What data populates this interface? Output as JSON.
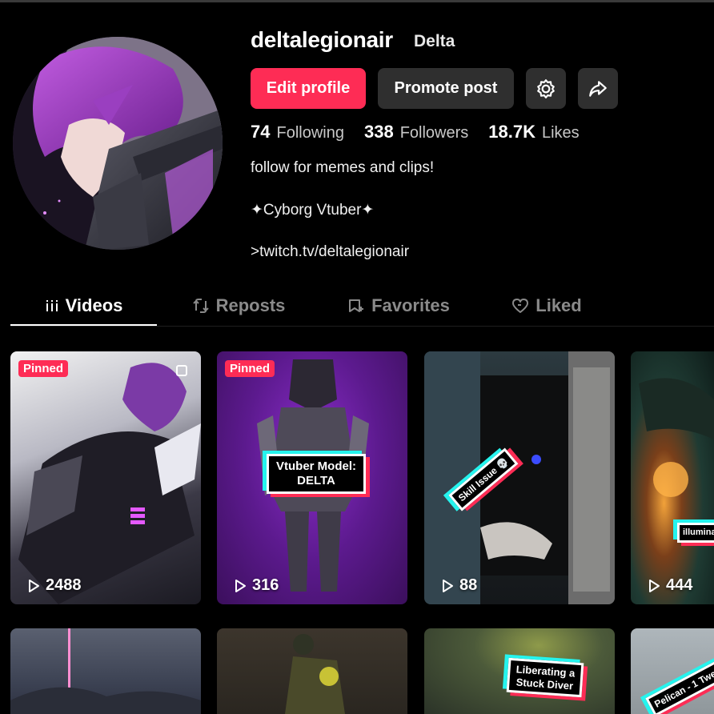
{
  "profile": {
    "username": "deltalegionair",
    "nickname": "Delta",
    "edit_label": "Edit profile",
    "promote_label": "Promote post",
    "stats": {
      "following_count": "74",
      "following_label": "Following",
      "followers_count": "338",
      "followers_label": "Followers",
      "likes_count": "18.7K",
      "likes_label": "Likes"
    },
    "bio": [
      "follow for memes and clips!",
      "✦Cyborg Vtuber✦",
      ">twitch.tv/deltalegionair"
    ]
  },
  "tabs": [
    {
      "label": "Videos",
      "icon": "grid-icon",
      "active": true
    },
    {
      "label": "Reposts",
      "icon": "repost-icon",
      "active": false
    },
    {
      "label": "Favorites",
      "icon": "bookmark-icon",
      "active": false
    },
    {
      "label": "Liked",
      "icon": "heart-icon",
      "active": false
    }
  ],
  "videos": [
    {
      "views": "2488",
      "pinned": "Pinned",
      "caption": ""
    },
    {
      "views": "316",
      "pinned": "Pinned",
      "caption_line1": "Vtuber Model:",
      "caption_line2": "DELTA"
    },
    {
      "views": "88",
      "pinned": "",
      "caption": "Skill Issue 💀"
    },
    {
      "views": "444",
      "pinned": "",
      "caption": "illuminate"
    },
    {
      "caption": ""
    },
    {
      "caption": ""
    },
    {
      "caption_line1": "Liberating a",
      "caption_line2": "Stuck Diver"
    },
    {
      "caption": "Pelican - 1 Twe"
    }
  ],
  "colors": {
    "accent": "#fe2c55",
    "cyan": "#25f4ee",
    "button_dark": "#2f2f2f"
  }
}
